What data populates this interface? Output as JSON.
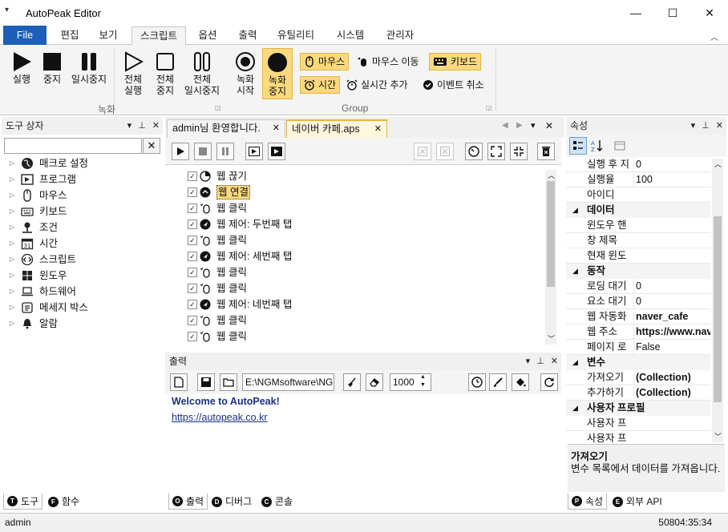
{
  "window": {
    "title": "AutoPeak Editor",
    "menu_icon": "▾",
    "minimize": "—",
    "maximize": "☐",
    "close": "✕"
  },
  "ribbon_tabs": [
    "File",
    "편집",
    "보기",
    "스크립트",
    "옵션",
    "출력",
    "유틸리티",
    "시스템",
    "관리자"
  ],
  "ribbon_active_tab": "스크립트",
  "ribbon": {
    "run": "실행",
    "stop": "중지",
    "pause": "일시중지",
    "run_all": [
      "전체",
      "실행"
    ],
    "stop_all": [
      "전체",
      "중지"
    ],
    "pause_all": [
      "전체",
      "일시중지"
    ],
    "record_start": [
      "녹화",
      "시작"
    ],
    "record_stop": [
      "녹화",
      "중지"
    ],
    "group_record": "녹화",
    "mouse": "마우스",
    "mouse_move": "마우스 이동",
    "keyboard": "키보드",
    "time": "시간",
    "realtime_add": "실시간 추가",
    "event_cancel": "이벤트 취소",
    "group_group": "Group"
  },
  "toolbox": {
    "title": "도구 상자",
    "search_value": "",
    "items": [
      "매크로 설정",
      "프로그램",
      "마우스",
      "키보드",
      "조건",
      "시간",
      "스크립트",
      "윈도우",
      "하드웨어",
      "메세지 박스",
      "알람"
    ],
    "calendar_num": "31",
    "tabs": [
      {
        "badge": "T",
        "label": "도구"
      },
      {
        "badge": "F",
        "label": "함수"
      }
    ]
  },
  "documents": {
    "tabs": [
      "admin님 환영합니다.",
      "네이버 카페.aps"
    ],
    "active": 1
  },
  "script": {
    "rows": [
      {
        "label": "웹 끊기",
        "icon": "web-disconnect",
        "selected": false
      },
      {
        "label": "웹 연결",
        "icon": "web-connect",
        "selected": true
      },
      {
        "label": "웹 클릭",
        "icon": "web-click",
        "selected": false
      },
      {
        "label": "웹 제어: 두번째 탭",
        "icon": "web-control",
        "selected": false
      },
      {
        "label": "웹 클릭",
        "icon": "web-click",
        "selected": false
      },
      {
        "label": "웹 제어: 세번째 탭",
        "icon": "web-control",
        "selected": false
      },
      {
        "label": "웹 클릭",
        "icon": "web-click",
        "selected": false
      },
      {
        "label": "웹 클릭",
        "icon": "web-click",
        "selected": false
      },
      {
        "label": "웹 제어: 네번째 탭",
        "icon": "web-control",
        "selected": false
      },
      {
        "label": "웹 클릭",
        "icon": "web-click",
        "selected": false
      },
      {
        "label": "웹 클릭",
        "icon": "web-click",
        "selected": false
      }
    ]
  },
  "output": {
    "title": "출력",
    "path": "E:\\NGMsoftware\\NG",
    "interval": "1000",
    "lines": [
      "Welcome to AutoPeak!",
      "https://autopeak.co.kr"
    ],
    "tabs": [
      {
        "badge": "O",
        "label": "출력"
      },
      {
        "badge": "D",
        "label": "디버그"
      },
      {
        "badge": "C",
        "label": "콘솔"
      }
    ]
  },
  "properties": {
    "title": "속성",
    "rows": [
      {
        "type": "prop",
        "name": "실행 후 지",
        "value": "0",
        "bold": false
      },
      {
        "type": "prop",
        "name": "실행율",
        "value": "100",
        "bold": false
      },
      {
        "type": "prop",
        "name": "아이디",
        "value": "",
        "bold": false
      },
      {
        "type": "cat",
        "name": "데이터"
      },
      {
        "type": "prop",
        "name": "윈도우 핸",
        "value": "",
        "bold": false
      },
      {
        "type": "prop",
        "name": "창 제목",
        "value": "",
        "bold": false
      },
      {
        "type": "prop",
        "name": "현재 윈도",
        "value": "",
        "bold": false
      },
      {
        "type": "cat",
        "name": "동작"
      },
      {
        "type": "prop",
        "name": "로딩 대기",
        "value": "0",
        "bold": false
      },
      {
        "type": "prop",
        "name": "요소 대기",
        "value": "0",
        "bold": false
      },
      {
        "type": "prop",
        "name": "웹 자동화",
        "value": "naver_cafe",
        "bold": true
      },
      {
        "type": "prop",
        "name": "웹 주소",
        "value": "https://www.nav",
        "bold": true
      },
      {
        "type": "prop",
        "name": "페이지 로",
        "value": "False",
        "bold": false
      },
      {
        "type": "cat",
        "name": "변수"
      },
      {
        "type": "prop",
        "name": "가져오기",
        "value": "(Collection)",
        "bold": true
      },
      {
        "type": "prop",
        "name": "추가하기",
        "value": "(Collection)",
        "bold": true
      },
      {
        "type": "cat",
        "name": "사용자 프로필"
      },
      {
        "type": "prop",
        "name": "사용자 프",
        "value": "",
        "bold": false
      },
      {
        "type": "prop",
        "name": "사용자 프",
        "value": "",
        "bold": false
      }
    ],
    "desc_title": "가져오기",
    "desc_text": "변수 목록에서 데이터를 가져옵니다.",
    "tabs": [
      {
        "badge": "P",
        "label": "속성"
      },
      {
        "badge": "E",
        "label": "외부 API"
      }
    ]
  },
  "status": {
    "user": "admin",
    "clock": "50804:35:34"
  }
}
